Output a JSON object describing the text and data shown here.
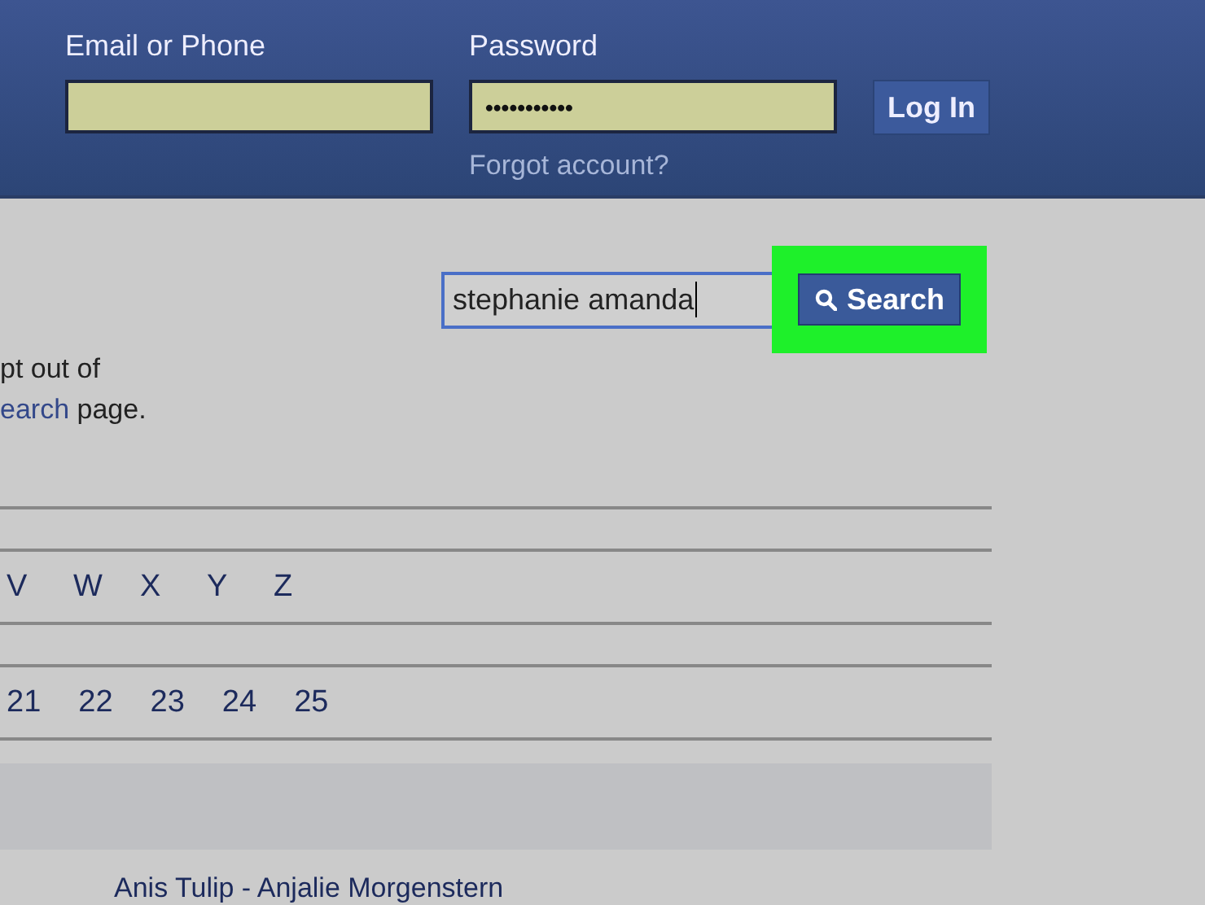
{
  "header": {
    "email_label": "Email or Phone",
    "password_label": "Password",
    "password_value": "•••••••••••",
    "login_button": "Log In",
    "forgot_link": "Forgot account?"
  },
  "search": {
    "value": "stephanie amanda",
    "button": "Search",
    "highlighted": true
  },
  "notice": {
    "line_1": "pt out of",
    "link": "earch",
    "line_2_rest": "page."
  },
  "letters": [
    "V",
    "W",
    "X",
    "Y",
    "Z"
  ],
  "pages": [
    "21",
    "22",
    "23",
    "24",
    "25"
  ],
  "result": "Anis Tulip - Anjalie Morgenstern"
}
